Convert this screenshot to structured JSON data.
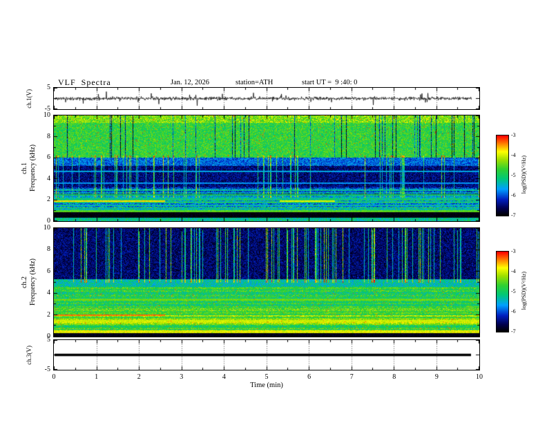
{
  "header": {
    "title": "VLF  Spectra",
    "date": "Jan. 12, 2026",
    "station": "station=ATH",
    "start_ut": "start UT =  9 :40: 0"
  },
  "x_axis": {
    "label": "Time (min)",
    "range": [
      0,
      10
    ],
    "ticks": [
      0,
      1,
      2,
      3,
      4,
      5,
      6,
      7,
      8,
      9,
      10
    ]
  },
  "colormap": [
    {
      "t": 0.0,
      "c": "#000000"
    },
    {
      "t": 0.09,
      "c": "#000050"
    },
    {
      "t": 0.2,
      "c": "#0020c0"
    },
    {
      "t": 0.33,
      "c": "#00a0ff"
    },
    {
      "t": 0.46,
      "c": "#00c878"
    },
    {
      "t": 0.58,
      "c": "#30d030"
    },
    {
      "t": 0.7,
      "c": "#a0e000"
    },
    {
      "t": 0.8,
      "c": "#ffff00"
    },
    {
      "t": 0.9,
      "c": "#ff8000"
    },
    {
      "t": 1.0,
      "c": "#ff0000"
    }
  ],
  "chart_data": [
    {
      "type": "line",
      "name": "ch1-waveform",
      "ylabel": "ch.1(V)",
      "ylim": [
        -5,
        5
      ],
      "yticks": [
        5,
        -5
      ],
      "x_range": [
        0,
        10
      ],
      "description": "broadband VLF noise about 0 V, ~±1 V with impulsive sferic spikes to ±4 V",
      "model": {
        "seed": 11,
        "noise_sigma": 0.45,
        "spike_prob": 0.025,
        "spike_scale": 2.8
      }
    },
    {
      "type": "heatmap",
      "name": "ch1-spectrogram",
      "ylabel_lines": [
        "ch.1",
        "Frequency (kHz)"
      ],
      "ylim": [
        0,
        10
      ],
      "yticks": [
        0,
        2,
        4,
        6,
        8,
        10
      ],
      "x_range": [
        0,
        10
      ],
      "colorbar": {
        "label": "log(PSD)(V²/Hz)",
        "range": [
          -7,
          -3
        ],
        "ticks": [
          -3,
          -4,
          -5,
          -6,
          -7
        ]
      },
      "model": {
        "seed": 23,
        "bands": [
          {
            "f0": 0.0,
            "f1": 0.3,
            "v": -5.2,
            "nb": 0.5
          },
          {
            "f0": 0.3,
            "f1": 0.85,
            "v": -6.95,
            "nb": 0.15
          },
          {
            "f0": 0.85,
            "f1": 1.05,
            "v": -4.6,
            "nb": 0.3
          },
          {
            "f0": 1.05,
            "f1": 2.2,
            "v": -5.35,
            "nb": 0.55,
            "stripes": 1.0
          },
          {
            "f0": 2.2,
            "f1": 3.2,
            "v": -5.75,
            "nb": 0.5,
            "stripes": 1.0
          },
          {
            "f0": 3.2,
            "f1": 5.2,
            "v": -6.5,
            "nb": 0.4
          },
          {
            "f0": 5.2,
            "f1": 6.0,
            "v": -5.9,
            "nb": 0.45
          },
          {
            "f0": 6.0,
            "f1": 9.3,
            "v": -4.75,
            "nb": 0.5
          },
          {
            "f0": 9.3,
            "f1": 10.01,
            "v": -4.35,
            "nb": 0.55
          }
        ],
        "v_streaks": {
          "prob": 0.1,
          "boost": 1.45,
          "f0": 2.2,
          "f1": 6.2
        },
        "dark_streaks": {
          "prob": 0.07,
          "boost": -1.7,
          "f0": 6.0,
          "f1": 10.01
        },
        "h_lines": [
          {
            "f": 0.93,
            "w": 0.07,
            "v": -4.5,
            "x0": 0.0,
            "x1": 10.0
          },
          {
            "f": 1.9,
            "w": 0.06,
            "v": -3.7,
            "x0": 0.0,
            "x1": 2.6
          },
          {
            "f": 1.9,
            "w": 0.06,
            "v": -3.9,
            "x0": 5.3,
            "x1": 6.6
          },
          {
            "f": 2.5,
            "w": 0.05,
            "v": -4.9,
            "x0": 0.0,
            "x1": 10.0
          },
          {
            "f": 2.9,
            "w": 0.05,
            "v": -5.05,
            "x0": 0.0,
            "x1": 10.0
          },
          {
            "f": 3.6,
            "w": 0.05,
            "v": -5.7,
            "x0": 0.0,
            "x1": 10.0
          },
          {
            "f": 4.7,
            "w": 0.05,
            "v": -5.55,
            "x0": 0.0,
            "x1": 10.0
          }
        ],
        "hot_speckle": {
          "prob": 0.01,
          "v": -3.2,
          "f0": 6.0,
          "f1": 10.01
        }
      }
    },
    {
      "type": "heatmap",
      "name": "ch2-spectrogram",
      "ylabel_lines": [
        "ch.2",
        "Frequency (kHz)"
      ],
      "ylim": [
        0,
        10
      ],
      "yticks": [
        0,
        2,
        4,
        6,
        8,
        10
      ],
      "x_range": [
        0,
        10
      ],
      "colorbar": {
        "label": "log(PSD)(V²/Hz)",
        "range": [
          -7,
          -3
        ],
        "ticks": [
          -3,
          -4,
          -5,
          -6,
          -7
        ]
      },
      "model": {
        "seed": 37,
        "bands": [
          {
            "f0": 0.0,
            "f1": 0.35,
            "v": -6.9,
            "nb": 0.15
          },
          {
            "f0": 0.35,
            "f1": 0.55,
            "v": -3.9,
            "nb": 0.3
          },
          {
            "f0": 0.55,
            "f1": 1.1,
            "v": -4.75,
            "nb": 0.45,
            "stripes": 0.7
          },
          {
            "f0": 1.1,
            "f1": 1.75,
            "v": -4.15,
            "nb": 0.4,
            "stripes": 0.6
          },
          {
            "f0": 1.75,
            "f1": 2.6,
            "v": -4.55,
            "nb": 0.45,
            "stripes": 0.8
          },
          {
            "f0": 2.6,
            "f1": 4.6,
            "v": -4.85,
            "nb": 0.5,
            "stripes": 0.6
          },
          {
            "f0": 4.6,
            "f1": 5.3,
            "v": -5.3,
            "nb": 0.5
          },
          {
            "f0": 5.3,
            "f1": 10.01,
            "v": -6.55,
            "nb": 0.4
          }
        ],
        "v_streaks": {
          "prob": 0.17,
          "boost": 1.7,
          "f0": 5.0,
          "f1": 10.01
        },
        "h_lines": [
          {
            "f": 1.45,
            "w": 0.1,
            "v": -4.0,
            "x0": 0.0,
            "x1": 10.0
          },
          {
            "f": 2.0,
            "w": 0.07,
            "v": -3.35,
            "x0": 0.0,
            "x1": 2.6
          },
          {
            "f": 3.4,
            "w": 0.08,
            "v": -4.45,
            "x0": 0.0,
            "x1": 10.0
          }
        ],
        "hot_speckle": {
          "prob": 0.012,
          "v": -3.3,
          "f0": 0.6,
          "f1": 4.6
        }
      }
    },
    {
      "type": "line",
      "name": "ch3-waveform",
      "ylabel": "ch.3(V)",
      "ylim": [
        -5,
        5
      ],
      "yticks": [
        5,
        -5
      ],
      "x_range": [
        0,
        10
      ],
      "constant_value": 0,
      "description": "flat heavy trace at 0 V (channel inactive)",
      "model": {
        "seed": 5
      }
    }
  ]
}
